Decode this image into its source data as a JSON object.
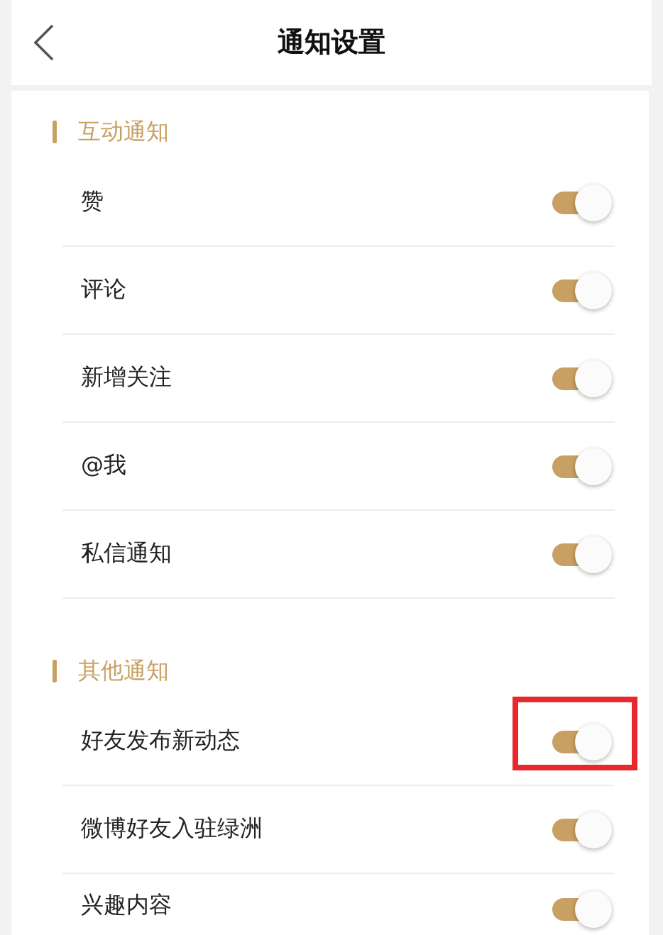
{
  "header": {
    "title": "通知设置"
  },
  "sections": [
    {
      "title": "互动通知",
      "items": [
        {
          "label": "赞",
          "on": true,
          "highlighted": false
        },
        {
          "label": "评论",
          "on": true,
          "highlighted": false
        },
        {
          "label": "新增关注",
          "on": true,
          "highlighted": false
        },
        {
          "label": "@我",
          "on": true,
          "highlighted": false
        },
        {
          "label": "私信通知",
          "on": true,
          "highlighted": false
        }
      ]
    },
    {
      "title": "其他通知",
      "items": [
        {
          "label": "好友发布新动态",
          "on": true,
          "highlighted": true
        },
        {
          "label": "微博好友入驻绿洲",
          "on": true,
          "highlighted": false
        },
        {
          "label": "兴趣内容",
          "on": true,
          "highlighted": false
        }
      ]
    }
  ]
}
